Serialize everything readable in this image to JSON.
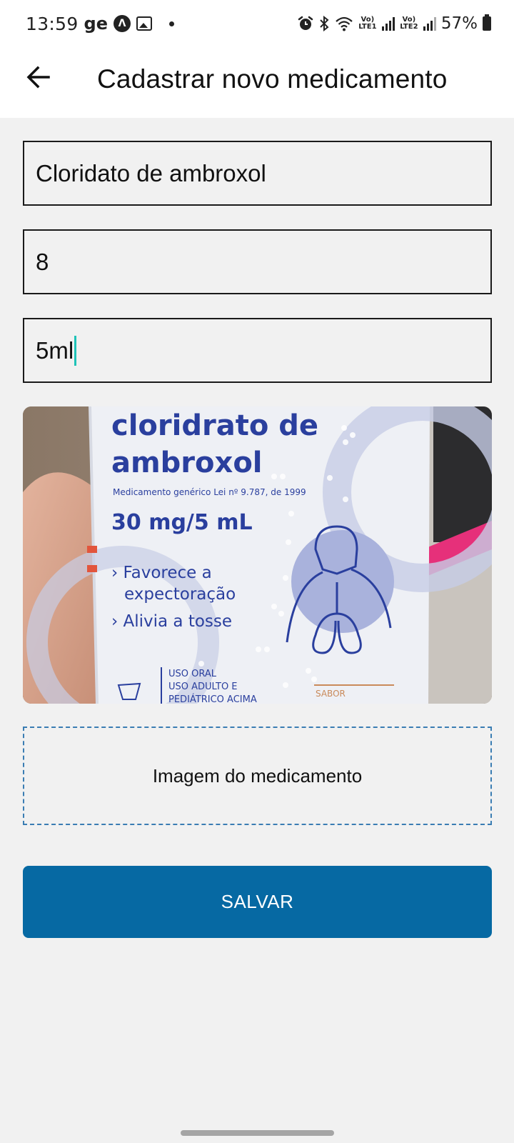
{
  "status_bar": {
    "time": "13:59",
    "carrier": "ge",
    "lte1": "Vo) LTE1",
    "lte2": "Vo) LTE2",
    "battery": "57%"
  },
  "app_bar": {
    "back_icon": "arrow-left-icon",
    "title": "Cadastrar novo medicamento"
  },
  "form": {
    "name_value": "Cloridato de ambroxol",
    "quantity_value": "8",
    "dose_value": "5ml",
    "image_caption": "Imagem do medicamento",
    "save_label": "SALVAR"
  },
  "photo": {
    "line1": "cloridrato de",
    "line2": "ambroxol",
    "law": "Medicamento genérico Lei nº 9.787, de 1999",
    "dose": "30 mg/5 mL",
    "bullet1a": "› Favorece a",
    "bullet1b": "expectoração",
    "bullet2": "› Alivia a tosse",
    "use1": "USO ORAL",
    "use2": "USO ADULTO E",
    "use3": "PEDIÁTRICO ACIMA",
    "flavor": "SABOR"
  },
  "colors": {
    "accent": "#0669a3",
    "dashed_border": "#3a7db3",
    "caret": "#1fc3b8",
    "box_text": "#2a3f9e"
  }
}
